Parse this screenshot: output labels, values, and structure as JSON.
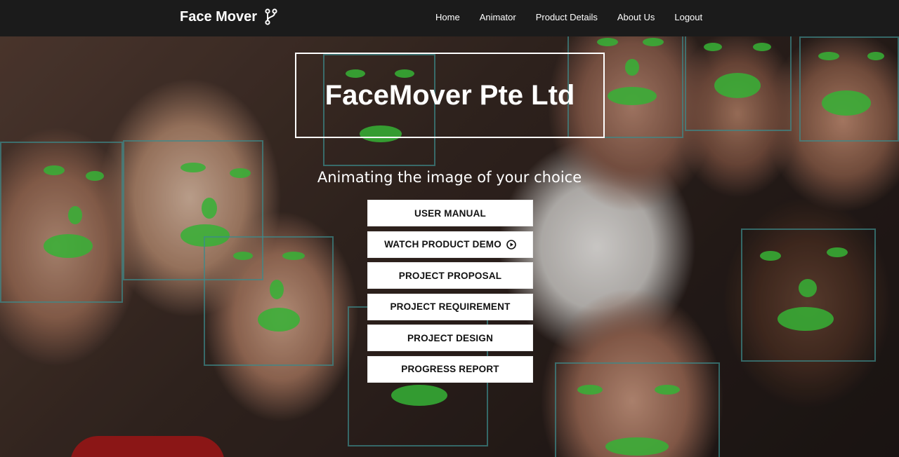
{
  "navbar": {
    "brand": "Face Mover",
    "brand_icon": "git-branch-icon",
    "links": [
      "Home",
      "Animator",
      "Product Details",
      "About Us",
      "Logout"
    ]
  },
  "hero": {
    "title": "FaceMover Pte Ltd",
    "subtitle": "Animating the image of your choice",
    "buttons": [
      "USER MANUAL",
      "WATCH PRODUCT DEMO",
      "PROJECT PROPOSAL",
      "PROJECT REQUIREMENT",
      "PROJECT DESIGN",
      "PROGRESS REPORT"
    ],
    "demo_icon": "play-circle-icon"
  },
  "colors": {
    "navbar_bg": "#1b1b1b",
    "landmark_green": "#3cdc3c",
    "box_teal": "#46aaaa"
  }
}
